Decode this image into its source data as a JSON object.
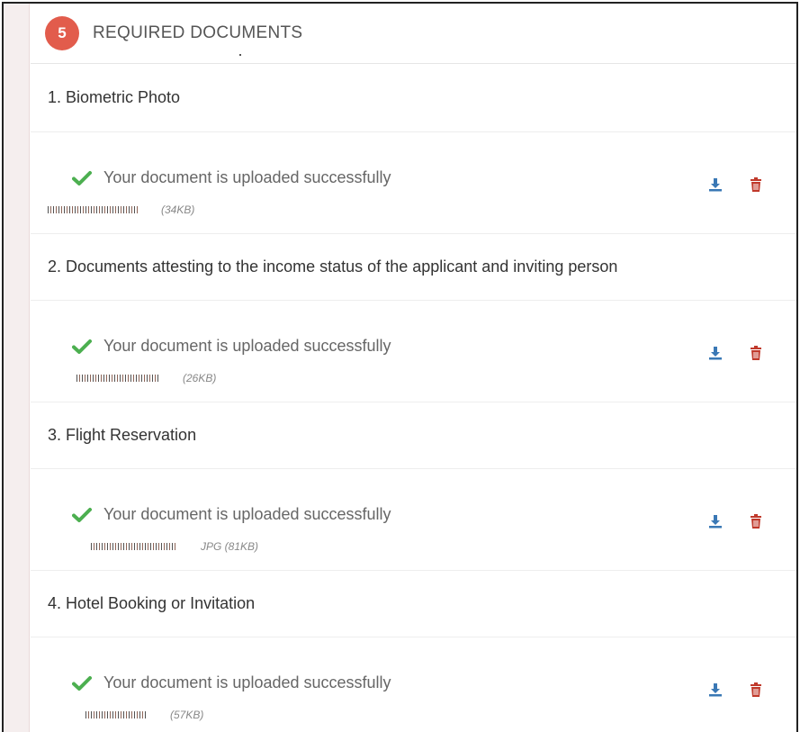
{
  "section": {
    "step_number": "5",
    "title": "REQUIRED DOCUMENTS"
  },
  "documents": [
    {
      "title": "1. Biometric Photo",
      "status": "Your document is uploaded successfully",
      "file_meta": "(34KB)"
    },
    {
      "title": "2. Documents attesting to the income status of the applicant and inviting person",
      "status": "Your document is uploaded successfully",
      "file_meta": "(26KB)"
    },
    {
      "title": "3. Flight Reservation",
      "status": "Your document is uploaded successfully",
      "file_meta": "JPG (81KB)"
    },
    {
      "title": "4. Hotel Booking or Invitation",
      "status": "Your document is uploaded successfully",
      "file_meta": "(57KB)"
    }
  ],
  "colors": {
    "badge": "#e25c4c",
    "check": "#4caf50",
    "download": "#3a78b5",
    "delete": "#c0392b"
  },
  "icons": {
    "status": "check-icon",
    "download": "download-icon",
    "delete": "trash-icon"
  }
}
